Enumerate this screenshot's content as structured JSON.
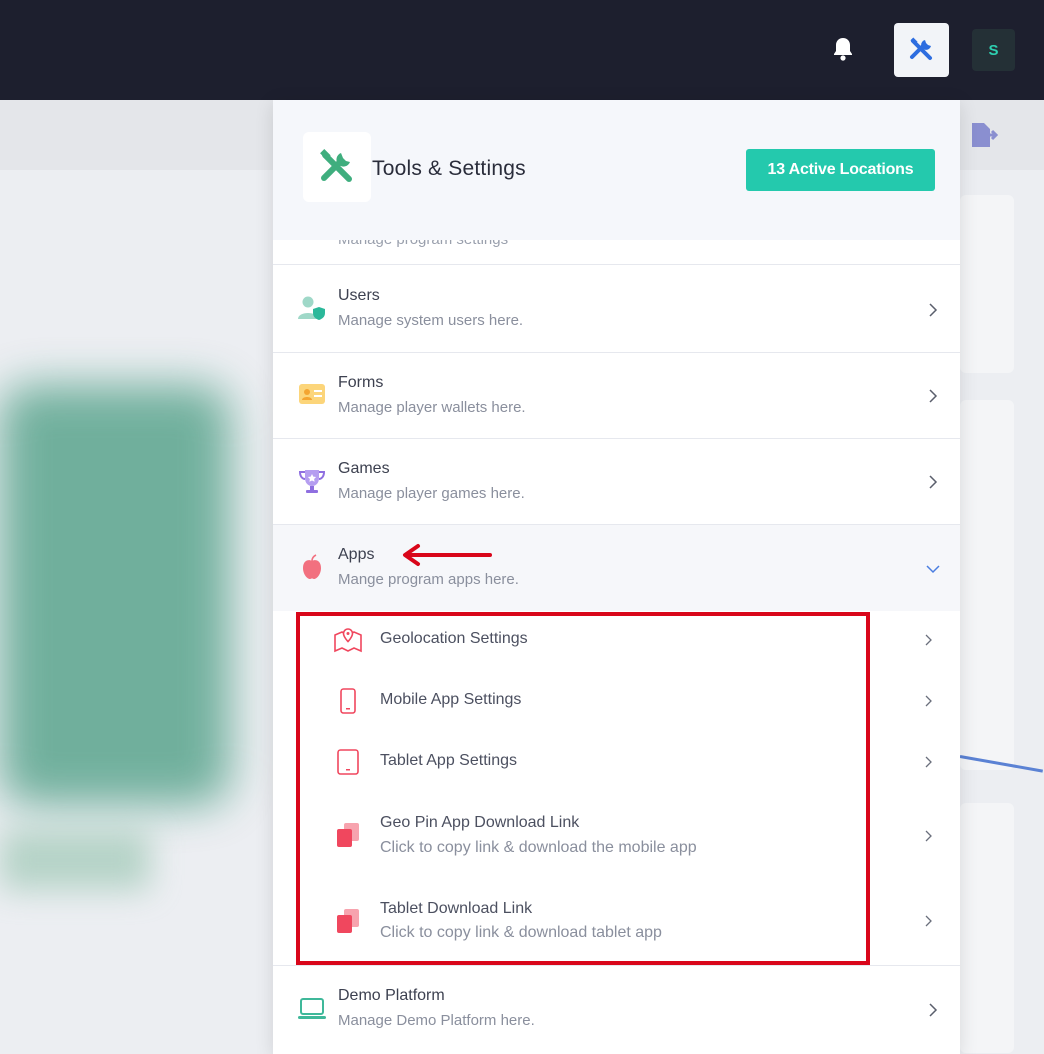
{
  "topbar": {
    "avatar_initial": "S",
    "icons": [
      "bell-icon",
      "tools-icon"
    ]
  },
  "panel": {
    "title": "Tools & Settings",
    "active_locations": "13 Active Locations",
    "cut_text": "Manage program settings"
  },
  "menu": {
    "users": {
      "title": "Users",
      "subtitle": "Manage system users here."
    },
    "forms": {
      "title": "Forms",
      "subtitle": "Manage player wallets here."
    },
    "games": {
      "title": "Games",
      "subtitle": "Manage player games here."
    },
    "apps": {
      "title": "Apps",
      "subtitle": "Mange program apps here."
    },
    "demo": {
      "title": "Demo Platform",
      "subtitle": "Manage Demo Platform here."
    }
  },
  "apps_submenu": [
    {
      "title": "Geolocation Settings"
    },
    {
      "title": "Mobile App Settings"
    },
    {
      "title": "Tablet App Settings"
    },
    {
      "title": "Geo Pin App Download Link",
      "subtitle": "Click to copy link & download the mobile app"
    },
    {
      "title": "Tablet Download Link",
      "subtitle": "Click to copy link & download tablet app"
    }
  ],
  "colors": {
    "accent": "#24c9ad",
    "topbar": "#1d1f2e",
    "annotation": "#d9061a",
    "sub_icon": "#f0475e"
  }
}
